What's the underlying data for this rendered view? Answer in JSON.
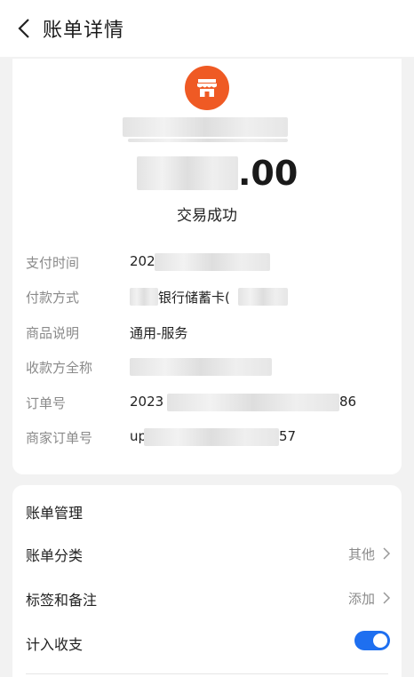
{
  "header": {
    "title": "账单详情"
  },
  "merchant": {
    "icon": "store-icon",
    "icon_color": "#ef5a24"
  },
  "amount": {
    "visible": ".00"
  },
  "status": "交易成功",
  "details": [
    {
      "label": "支付时间",
      "value": "202"
    },
    {
      "label": "付款方式",
      "value": "银行储蓄卡("
    },
    {
      "label": "商品说明",
      "value": "通用-服务"
    },
    {
      "label": "收款方全称",
      "value": ""
    },
    {
      "label": "订单号",
      "value_start": "2023",
      "value_end": "86"
    },
    {
      "label": "商家订单号",
      "value_start": "up",
      "value_end": "57"
    }
  ],
  "management": {
    "title": "账单管理",
    "category": {
      "label": "账单分类",
      "value": "其他"
    },
    "tags": {
      "label": "标签和备注",
      "value": "添加"
    },
    "income": {
      "label": "计入收支",
      "enabled": true,
      "toggle_color": "#1e6ff0"
    }
  }
}
